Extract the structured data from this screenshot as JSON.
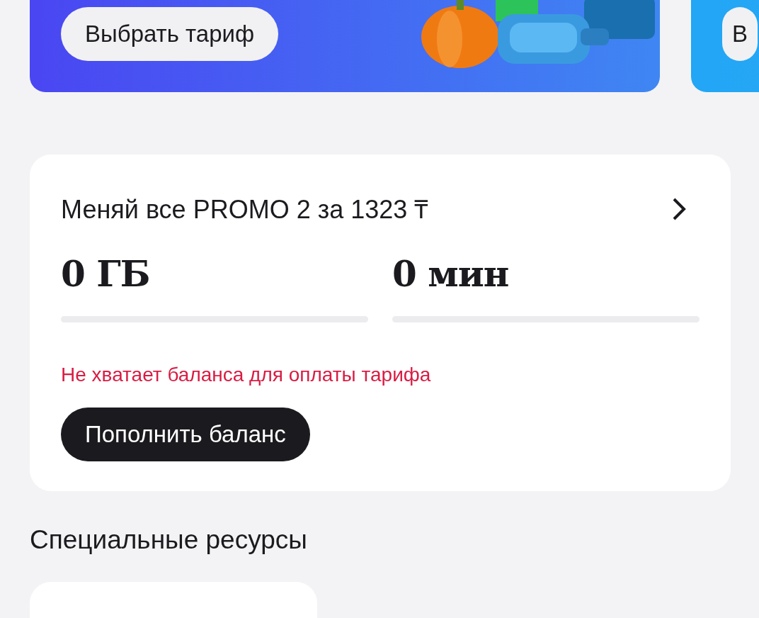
{
  "banners": [
    {
      "button": "Выбрать тариф",
      "kind": "picture"
    },
    {
      "button": "В"
    }
  ],
  "tariff_card": {
    "title": "Меняй все PROMO 2 за 1323 ₸",
    "resources": [
      {
        "amount": "0 ГБ",
        "level": 0
      },
      {
        "amount": "0 мин",
        "level": 0
      }
    ],
    "warning": "Не хватает баланса для оплаты тарифа",
    "button": "Пополнить баланс"
  },
  "section_title": "Специальные ресурсы"
}
